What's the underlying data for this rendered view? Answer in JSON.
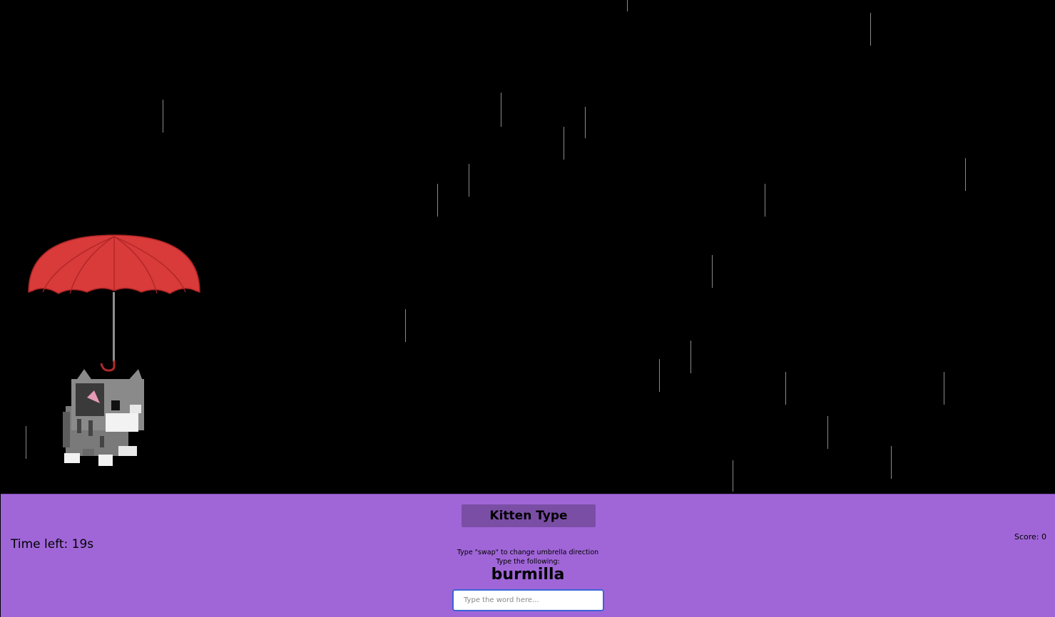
{
  "game": {
    "title": "Kitten Type",
    "time_label": "Time left: 19s",
    "time_left_seconds": 19,
    "score_label": "Score: 0",
    "score": 0,
    "instruction_swap": "Type \"swap\" to change umbrella direction",
    "instruction_type": "Type the following:",
    "target_word": "burmilla",
    "input": {
      "value": "",
      "placeholder": "Type the word here..."
    }
  },
  "colors": {
    "background": "#000000",
    "panel": "#a066d8",
    "title_button": "#7a4ea5",
    "umbrella": "#d93a3a",
    "rain": "#8a8a8a"
  },
  "icons": {
    "umbrella": "umbrella-icon",
    "kitten": "kitten-sprite"
  }
}
